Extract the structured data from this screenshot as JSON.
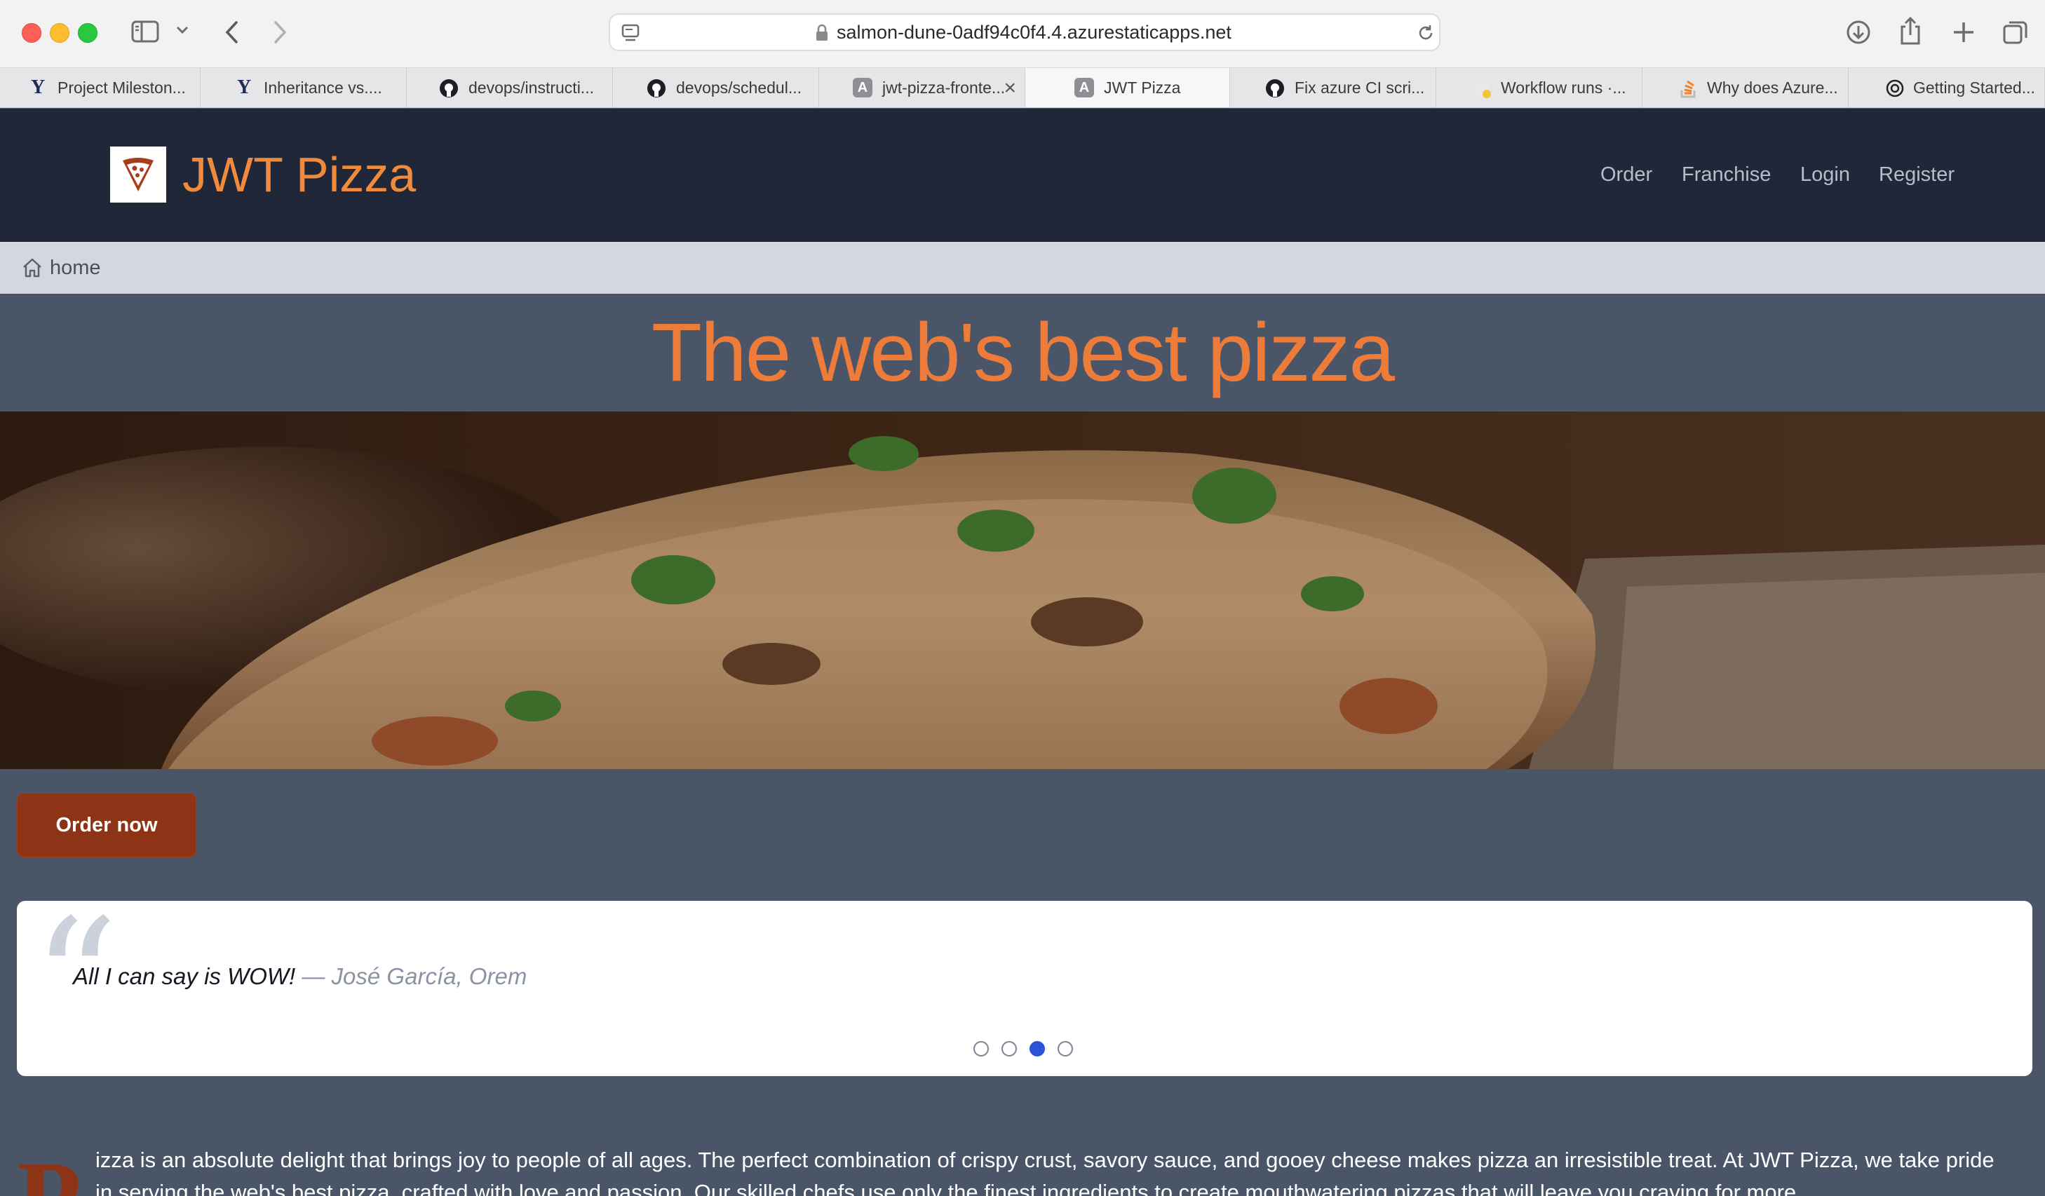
{
  "browser": {
    "url": "salmon-dune-0adf94c0f4.4.azurestaticapps.net",
    "tabs": [
      {
        "label": "Project Mileston...",
        "icon": "y-icon"
      },
      {
        "label": "Inheritance vs....",
        "icon": "y-icon"
      },
      {
        "label": "devops/instructi...",
        "icon": "github-icon"
      },
      {
        "label": "devops/schedul...",
        "icon": "github-icon"
      },
      {
        "label": "jwt-pizza-fronte...",
        "icon": "a-icon"
      },
      {
        "label": "JWT Pizza",
        "icon": "a-icon",
        "active": true
      },
      {
        "label": "Fix azure CI scri...",
        "icon": "github-icon"
      },
      {
        "label": "Workflow runs ·...",
        "icon": "workflow-icon"
      },
      {
        "label": "Why does Azure...",
        "icon": "stackoverflow-icon"
      },
      {
        "label": "Getting Started...",
        "icon": "openai-icon"
      }
    ]
  },
  "header": {
    "brand": "JWT Pizza",
    "nav": [
      "Order",
      "Franchise",
      "Login",
      "Register"
    ]
  },
  "breadcrumb": {
    "label": "home"
  },
  "hero": {
    "title": "The web's best pizza"
  },
  "cta": {
    "label": "Order now"
  },
  "testimonial": {
    "quote": "All I can say is WOW!",
    "author": "— José García, Orem",
    "dots_total": 4,
    "dots_active_index": 2
  },
  "about": {
    "dropcap": "P",
    "text": "izza is an absolute delight that brings joy to people of all ages. The perfect combination of crispy crust, savory sauce, and gooey cheese makes pizza an irresistible treat. At JWT Pizza, we take pride in serving the web's best pizza, crafted with love and passion. Our skilled chefs use only the finest ingredients to create mouthwatering pizzas that will leave you craving for more."
  },
  "colors": {
    "header_bg": "#1f2738",
    "page_bg": "#4b5568",
    "brand_orange": "#f08a3c",
    "cta_bg": "#8d3416",
    "active_dot": "#2954d8"
  }
}
